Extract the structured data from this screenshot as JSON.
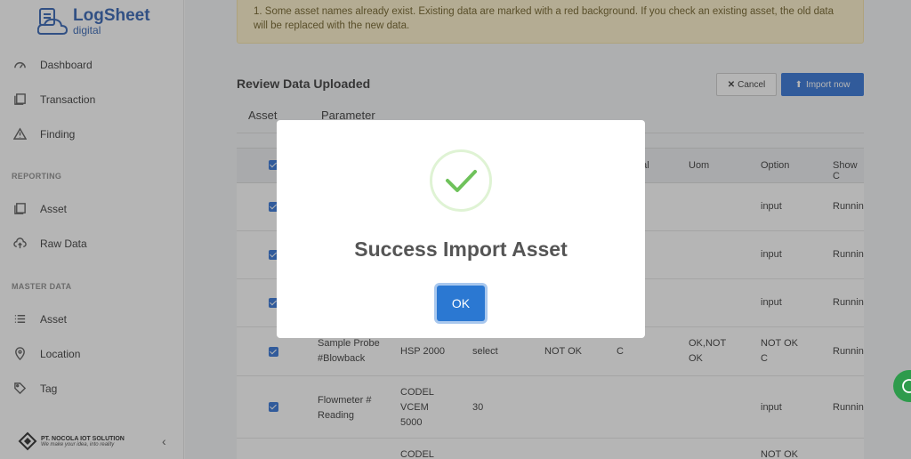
{
  "app": {
    "logo_main": "LogSheet",
    "logo_sub": "digital"
  },
  "sidebar": {
    "items": [
      {
        "label": "Dashboard"
      },
      {
        "label": "Transaction"
      },
      {
        "label": "Finding"
      }
    ],
    "reporting_label": "REPORTING",
    "reporting_items": [
      {
        "label": "Asset"
      },
      {
        "label": "Raw Data"
      }
    ],
    "master_label": "MASTER DATA",
    "master_items": [
      {
        "label": "Asset"
      },
      {
        "label": "Location"
      },
      {
        "label": "Tag"
      }
    ],
    "company_name": "PT. NOCOLA IOT SOLUTION",
    "company_tagline": "We make your idea, into reality"
  },
  "main": {
    "alert_text": "1. Some asset names already exist. Existing data are marked with a red background. If you check an existing asset, the old data will be replaced with the new data.",
    "review_title": "Review Data Uploaded",
    "cancel_label": "Cancel",
    "import_label": "Import now",
    "tabs": [
      {
        "label": "Asset"
      },
      {
        "label": "Parameter"
      }
    ],
    "table": {
      "headers": [
        "mal",
        "Uom",
        "Option",
        "Show C"
      ],
      "rows": [
        {
          "option": "input",
          "show": "Runnin"
        },
        {
          "option": "input",
          "show": "Runnin"
        },
        {
          "option": "input",
          "show": "Runnin"
        },
        {
          "name": "Sample Probe #Blowback",
          "tag": "HSP 2000",
          "type": "select",
          "val": "NOT OK",
          "c": "C",
          "uom": "OK,NOT OK",
          "option": "NOT OK C",
          "show": "Runnin"
        },
        {
          "name": "Flowmeter # Reading",
          "tag": "CODEL VCEM 5000",
          "type": "30",
          "option": "input",
          "show": "Runnin"
        },
        {
          "tag": "CODEL",
          "option": "NOT OK"
        }
      ]
    }
  },
  "modal": {
    "title": "Success Import Asset",
    "ok_label": "OK"
  },
  "colors": {
    "primary": "#2b6fd6",
    "success": "#6fc25b",
    "alert_bg": "#fdf1c9"
  }
}
